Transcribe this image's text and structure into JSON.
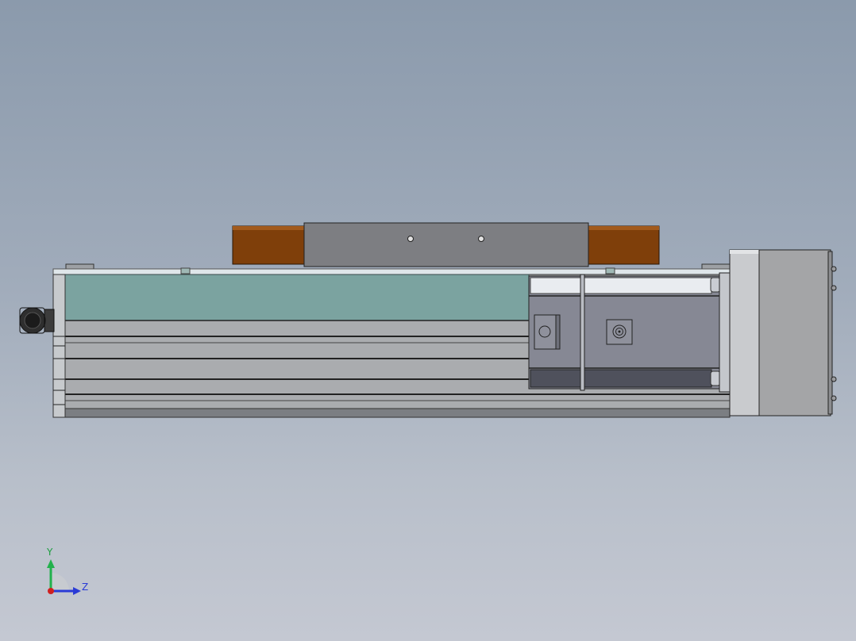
{
  "viewport": {
    "background_top": "#8b9aac",
    "background_bottom": "#c4c8d2"
  },
  "model": {
    "name": "linear-actuator-side-view",
    "carriage_color": "#7f3f0a",
    "profile_color": "#a9acaf",
    "cover_color": "#7ba3a0",
    "motor_color": "#868894"
  },
  "triad": {
    "y_label": "Y",
    "z_label": "Z",
    "y_color": "#22b14c",
    "z_color": "#2a3bd6",
    "x_color": "#d02020"
  }
}
